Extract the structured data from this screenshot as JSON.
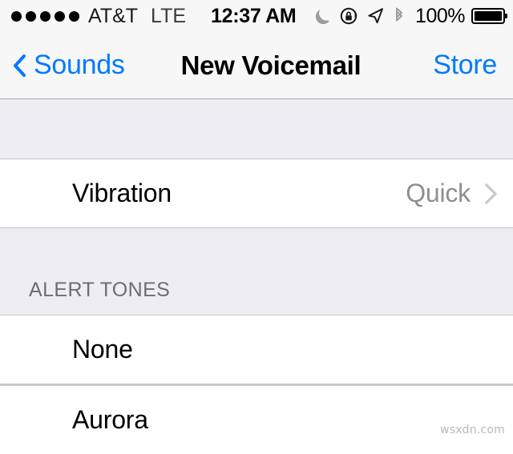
{
  "status_bar": {
    "signal_dots_filled": 5,
    "signal_dots_total": 5,
    "carrier": "AT&T",
    "network": "LTE",
    "time": "12:37 AM",
    "icons": [
      "moon-icon",
      "rotation-lock-icon",
      "location-arrow-icon",
      "bluetooth-icon"
    ],
    "battery_percent": "100%",
    "battery_level": 100
  },
  "nav_bar": {
    "back_label": "Sounds",
    "title": "New Voicemail",
    "right_label": "Store"
  },
  "sections": [
    {
      "header": "",
      "rows": [
        {
          "title": "Vibration",
          "value": "Quick",
          "accessory": "disclosure-chevron"
        }
      ]
    },
    {
      "header": "ALERT TONES",
      "rows": [
        {
          "title": "None",
          "value": "",
          "accessory": "none"
        },
        {
          "title": "Aurora",
          "value": "",
          "accessory": "none"
        }
      ]
    }
  ],
  "watermark": "wsxdn.com",
  "colors": {
    "tint": "#007aff",
    "group_background": "#eeeef2",
    "cell_background": "#ffffff",
    "separator": "#c8c7cc",
    "secondary_text": "#8e8e93",
    "header_text": "#6d6d72"
  }
}
